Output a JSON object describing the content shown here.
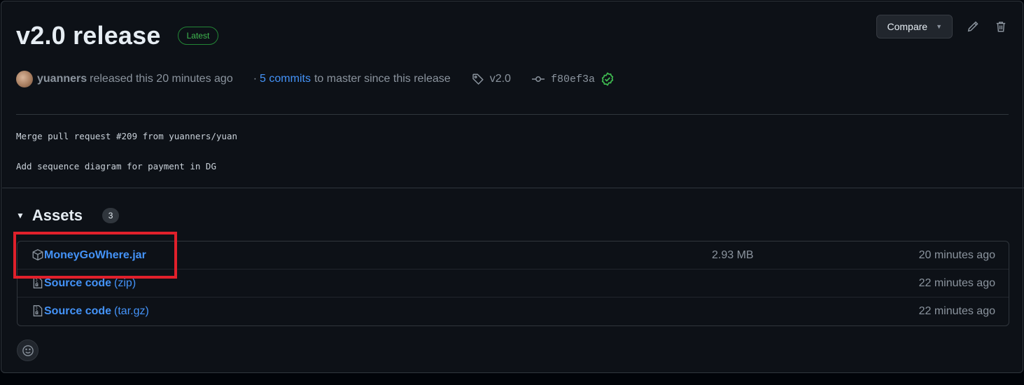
{
  "release": {
    "title": "v2.0 release",
    "latest_badge": "Latest",
    "author": "yuanners",
    "released_text": "released this 20 minutes ago",
    "separator": "·",
    "commits_link": "5 commits",
    "since_text": "to master since this release",
    "tag": "v2.0",
    "commit_sha": "f80ef3a"
  },
  "header_actions": {
    "compare_label": "Compare",
    "edit_icon": "pencil-icon",
    "delete_icon": "trash-icon"
  },
  "body": {
    "line1": "Merge pull request #209 from yuanners/yuan",
    "line2": "Add sequence diagram for payment in DG"
  },
  "assets": {
    "title": "Assets",
    "count": "3",
    "items": [
      {
        "name": "MoneyGoWhere.jar",
        "suffix": "",
        "size": "2.93 MB",
        "time": "20 minutes ago",
        "icon": "package-icon"
      },
      {
        "name": "Source code",
        "suffix": "(zip)",
        "size": "",
        "time": "22 minutes ago",
        "icon": "file-zip-icon"
      },
      {
        "name": "Source code",
        "suffix": "(tar.gz)",
        "size": "",
        "time": "22 minutes ago",
        "icon": "file-zip-icon"
      }
    ]
  },
  "colors": {
    "background": "#0d1117",
    "link": "#4493f8",
    "latest_green": "#3fb950",
    "highlight_red": "#e0202b"
  }
}
